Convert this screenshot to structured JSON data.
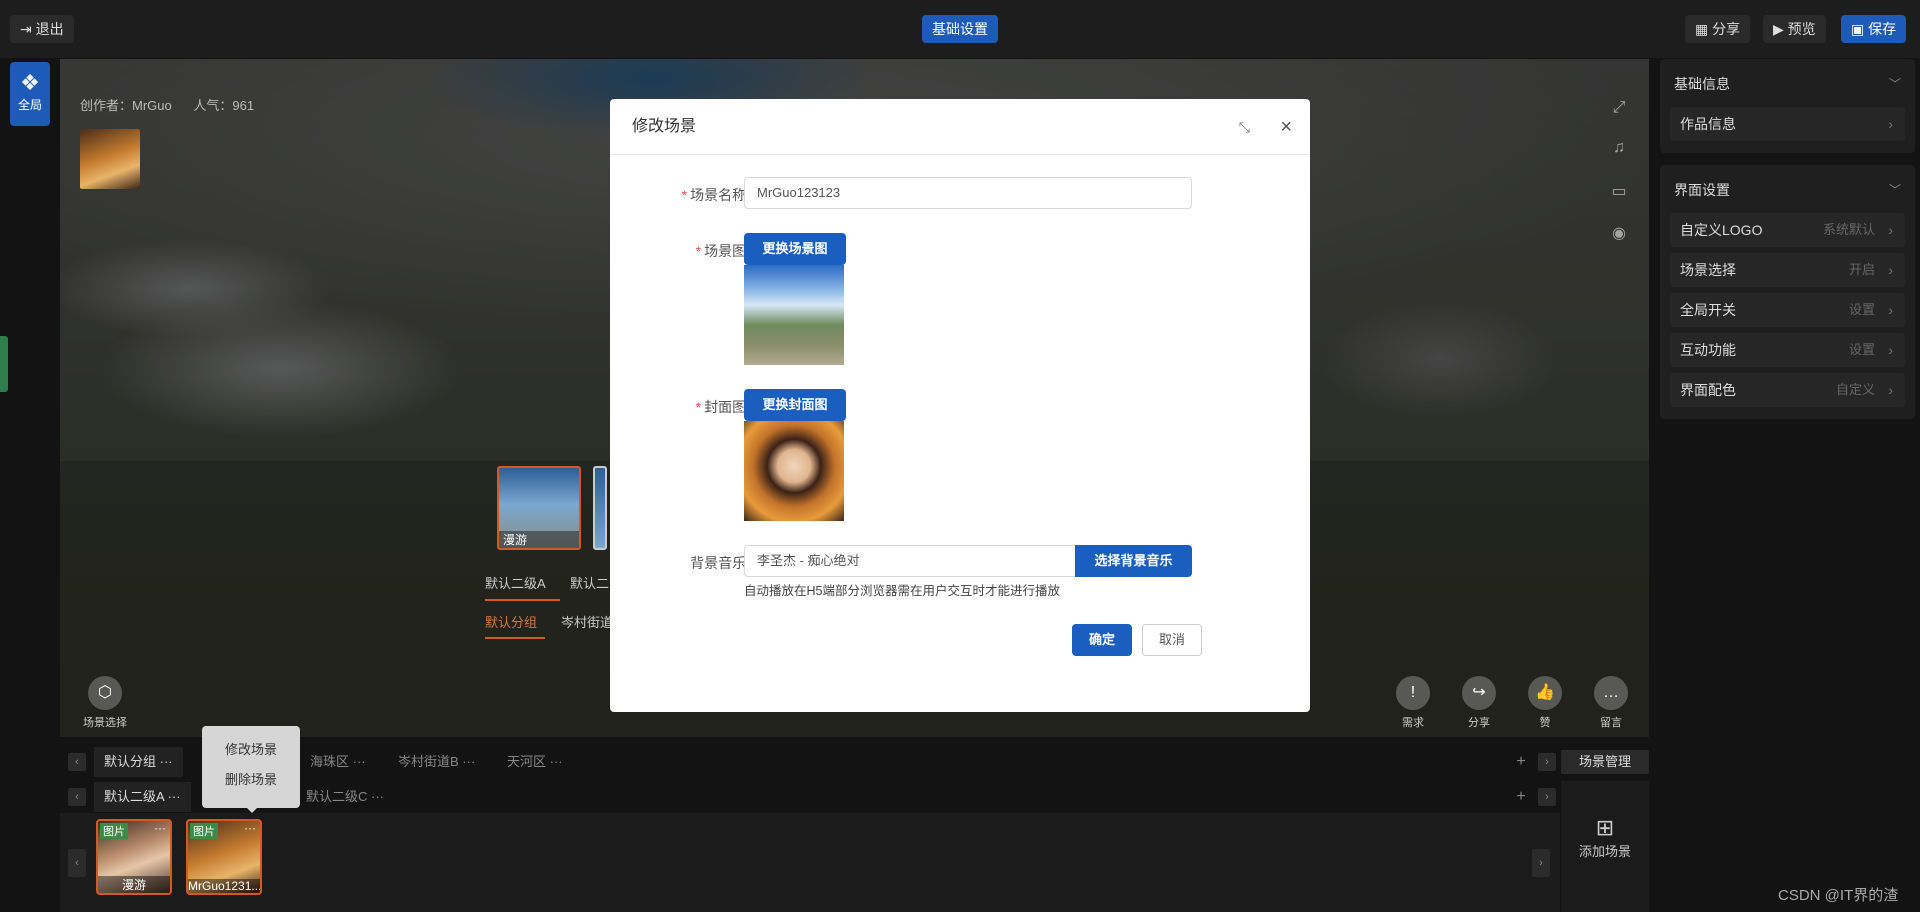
{
  "topbar": {
    "exit_label": "退出",
    "center_tab": "基础设置",
    "share_label": "分享",
    "preview_label": "预览",
    "save_label": "保存"
  },
  "left_tool": {
    "global_label": "全局"
  },
  "stage": {
    "author": "创作者：MrGuo",
    "popularity": "人气：961",
    "scene_card_caption": "漫游",
    "group_level2_a": "默认二级A",
    "group_level2_b": "默认二",
    "group_default": "默认分组",
    "group_next": "岑村街道",
    "scene_select_label": "场景选择",
    "actions": [
      "需求",
      "分享",
      "赞",
      "留言"
    ]
  },
  "modal": {
    "title": "修改场景",
    "scene_name_label": "场景名称:",
    "scene_name_value": "MrGuo123123",
    "scene_img_label": "场景图:",
    "change_scene_img_btn": "更换场景图",
    "cover_img_label": "封面图:",
    "change_cover_img_btn": "更换封面图",
    "bgm_label": "背景音乐:",
    "bgm_value": "李圣杰 - 痴心绝对",
    "select_bgm_btn": "选择背景音乐",
    "hint": "自动播放在H5端部分浏览器需在用户交互时才能进行播放",
    "confirm_btn": "确定",
    "cancel_btn": "取消"
  },
  "right_panel": {
    "basic_info": "基础信息",
    "work_info": "作品信息",
    "ui_settings": "界面设置",
    "items": [
      {
        "label": "自定义LOGO",
        "value": "系统默认"
      },
      {
        "label": "场景选择",
        "value": "开启"
      },
      {
        "label": "全局开关",
        "value": "设置"
      },
      {
        "label": "互动功能",
        "value": "设置"
      },
      {
        "label": "界面配色",
        "value": "自定义"
      }
    ]
  },
  "bottom": {
    "groups": [
      "默认分组",
      "海珠区",
      "岑村街道B",
      "天河区"
    ],
    "subgroups": [
      "默认二级A",
      "默认二级C"
    ],
    "dots": "···",
    "scene_manager": "场景管理",
    "add_scene": "添加场景",
    "thumbs": [
      {
        "tag": "图片",
        "caption": "漫游"
      },
      {
        "tag": "图片",
        "caption": "MrGuo1231..."
      }
    ],
    "context_menu": [
      "修改场景",
      "删除场景"
    ]
  },
  "watermark": "CSDN @IT界的渣"
}
